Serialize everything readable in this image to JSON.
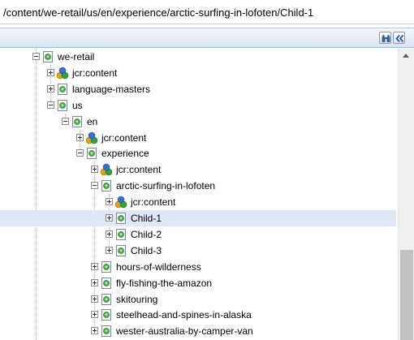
{
  "path_bar": {
    "value": "/content/we-retail/us/en/experience/arctic-surfing-in-lofoten/Child-1"
  },
  "toolbar": {
    "refresh_icon": "binoculars-icon",
    "collapse_icon": "double-chevron-left-icon"
  },
  "tree": {
    "nodes": [
      {
        "label": "we-retail",
        "icon": "page-icon",
        "expander": "minus"
      },
      {
        "label": "jcr:content",
        "icon": "jcr-content-icon",
        "expander": "plus"
      },
      {
        "label": "language-masters",
        "icon": "page-icon",
        "expander": "plus"
      },
      {
        "label": "us",
        "icon": "page-icon",
        "expander": "minus"
      },
      {
        "label": "en",
        "icon": "page-icon",
        "expander": "minus"
      },
      {
        "label": "jcr:content",
        "icon": "jcr-content-icon",
        "expander": "plus"
      },
      {
        "label": "experience",
        "icon": "page-icon",
        "expander": "minus"
      },
      {
        "label": "jcr:content",
        "icon": "jcr-content-icon",
        "expander": "plus"
      },
      {
        "label": "arctic-surfing-in-lofoten",
        "icon": "page-icon",
        "expander": "minus"
      },
      {
        "label": "jcr:content",
        "icon": "jcr-content-icon",
        "expander": "plus"
      },
      {
        "label": "Child-1",
        "icon": "page-icon",
        "expander": "plus",
        "selected": true
      },
      {
        "label": "Child-2",
        "icon": "page-icon",
        "expander": "plus"
      },
      {
        "label": "Child-3",
        "icon": "page-icon",
        "expander": "plus"
      },
      {
        "label": "hours-of-wilderness",
        "icon": "page-icon",
        "expander": "plus"
      },
      {
        "label": "fly-fishing-the-amazon",
        "icon": "page-icon",
        "expander": "plus"
      },
      {
        "label": "skitouring",
        "icon": "page-icon",
        "expander": "plus"
      },
      {
        "label": "steelhead-and-spines-in-alaska",
        "icon": "page-icon",
        "expander": "plus"
      },
      {
        "label": "wester-australia-by-camper-van",
        "icon": "page-icon",
        "expander": "plus"
      }
    ]
  },
  "colors": {
    "selection": "#dfe8f6",
    "toolbar": "#dbe5f1",
    "scroll_thumb": "#c1c1c1"
  }
}
